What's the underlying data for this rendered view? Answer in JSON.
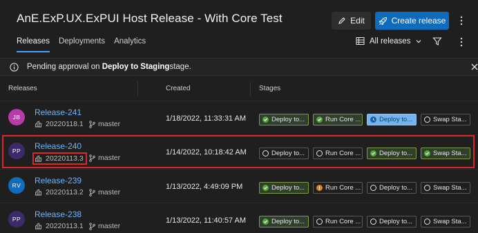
{
  "page": {
    "title": "AnE.ExP.UX.ExPUI Host Release - With Core Test",
    "edit_label": "Edit",
    "create_label": "Create release"
  },
  "tabs": [
    "Releases",
    "Deployments",
    "Analytics"
  ],
  "view_selector": "All releases",
  "banner": {
    "prefix": "Pending approval on ",
    "stage": "Deploy to Staging",
    "suffix": " stage."
  },
  "columns": [
    "Releases",
    "Created",
    "Stages"
  ],
  "releases": [
    {
      "initials": "JB",
      "avatar_color": "#b63cab",
      "name": "Release-241",
      "build": "20220118.1",
      "branch": "master",
      "created": "1/18/2022, 11:33:31 AM",
      "stages": [
        {
          "label": "Deploy to...",
          "status": "success"
        },
        {
          "label": "Run Core ...",
          "status": "success"
        },
        {
          "label": "Deploy to...",
          "status": "in-progress"
        },
        {
          "label": "Swap Sta...",
          "status": "not-started"
        }
      ]
    },
    {
      "initials": "PP",
      "avatar_color": "#3c2a6b",
      "name": "Release-240",
      "build": "20220113.3",
      "branch": "master",
      "created": "1/14/2022, 10:18:42 AM",
      "stages": [
        {
          "label": "Deploy to...",
          "status": "not-started"
        },
        {
          "label": "Run Core ...",
          "status": "not-started"
        },
        {
          "label": "Deploy to...",
          "status": "success"
        },
        {
          "label": "Swap Sta...",
          "status": "success"
        }
      ]
    },
    {
      "initials": "RV",
      "avatar_color": "#0f6cbd",
      "name": "Release-239",
      "build": "20220113.2",
      "branch": "master",
      "created": "1/13/2022, 4:49:09 PM",
      "stages": [
        {
          "label": "Deploy to...",
          "status": "success"
        },
        {
          "label": "Run Core ...",
          "status": "warning"
        },
        {
          "label": "Deploy to...",
          "status": "not-started"
        },
        {
          "label": "Swap Sta...",
          "status": "not-started"
        }
      ]
    },
    {
      "initials": "PP",
      "avatar_color": "#3c2a6b",
      "name": "Release-238",
      "build": "20220113.1",
      "branch": "master",
      "created": "1/13/2022, 11:40:57 AM",
      "stages": [
        {
          "label": "Deploy to...",
          "status": "success"
        },
        {
          "label": "Run Core ...",
          "status": "not-started"
        },
        {
          "label": "Deploy to...",
          "status": "not-started"
        },
        {
          "label": "Swap Sta...",
          "status": "not-started"
        }
      ]
    }
  ],
  "colors": {
    "accent": "#0f6cbd",
    "link": "#6cb6ff",
    "success": "#54a63c",
    "warning": "#e5811c",
    "highlight": "#e0242b"
  }
}
